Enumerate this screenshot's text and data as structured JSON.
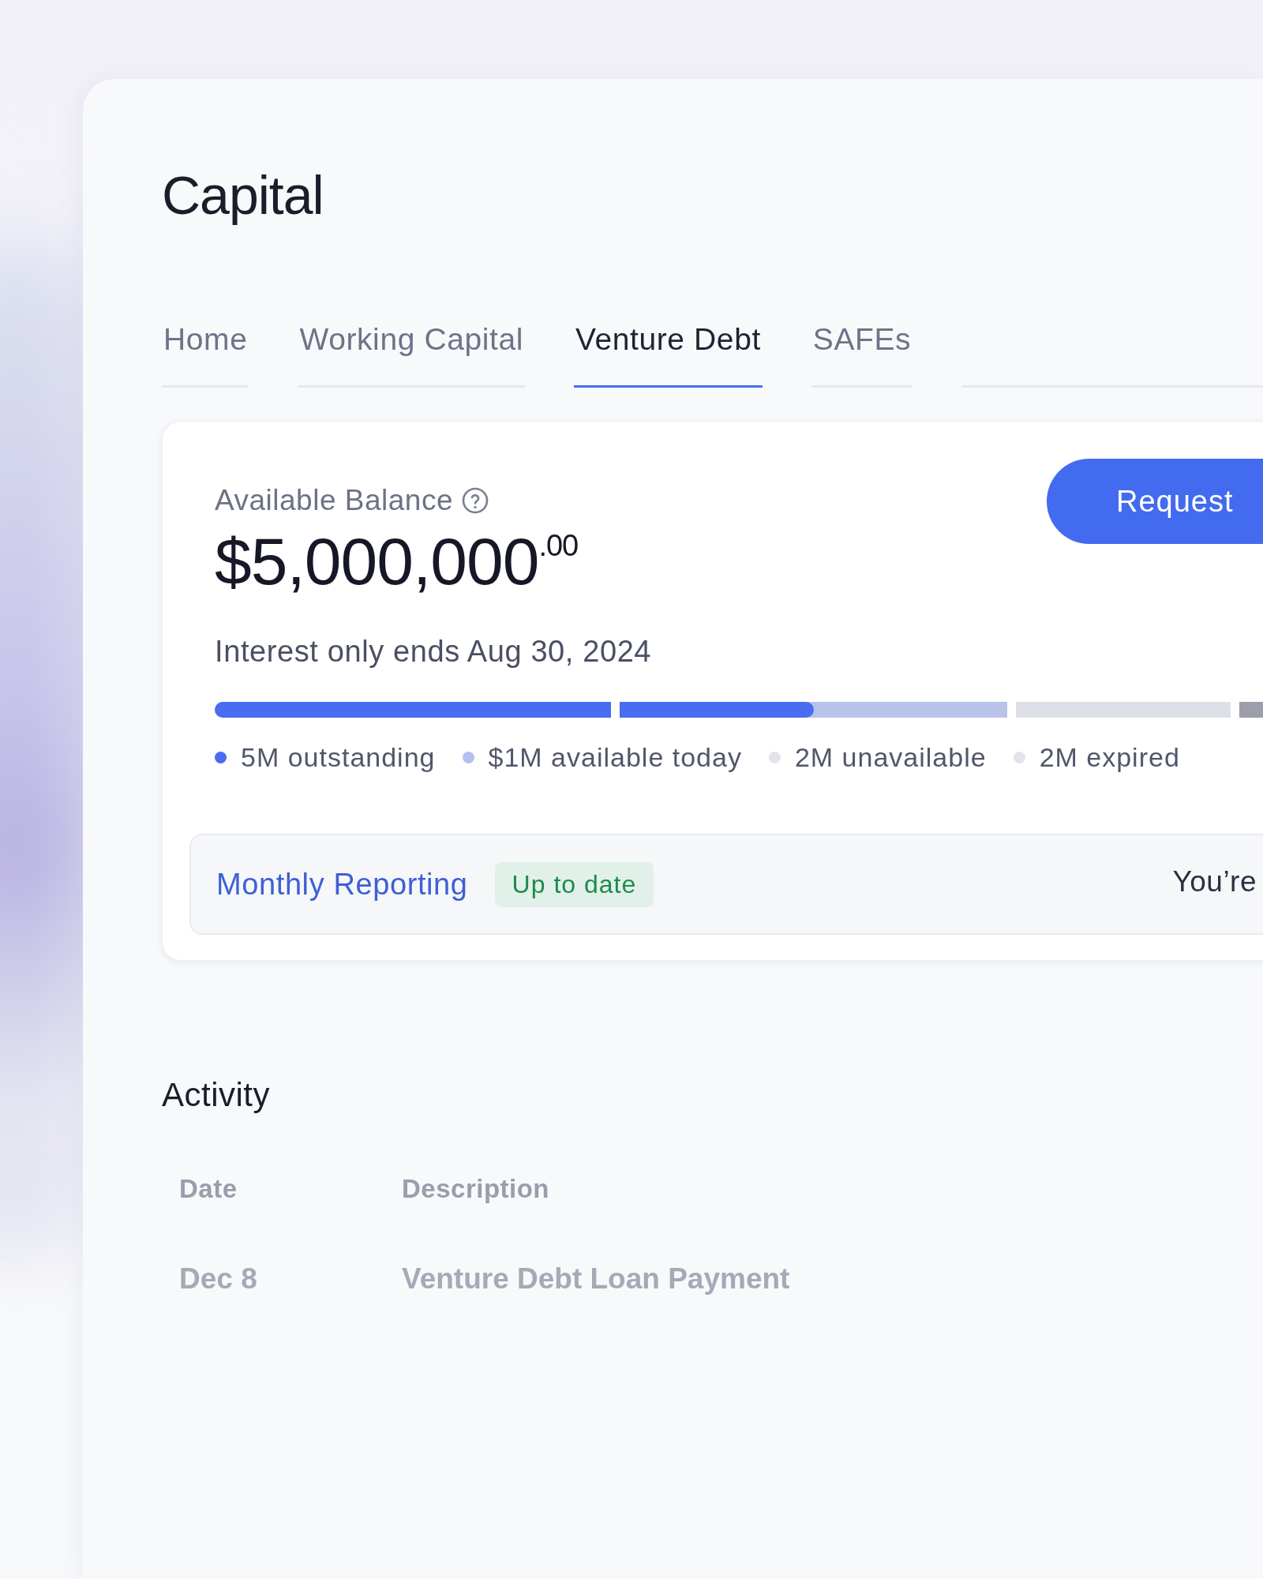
{
  "page": {
    "title": "Capital"
  },
  "tabs": [
    {
      "label": "Home",
      "selected": false
    },
    {
      "label": "Working Capital",
      "selected": false
    },
    {
      "label": "Venture Debt",
      "selected": true
    },
    {
      "label": "SAFEs",
      "selected": false
    }
  ],
  "balance": {
    "label": "Available Balance",
    "amount": "$5,000,000$^{.00}$",
    "button": "Request",
    "note": "Interest only ends Aug 30, 2024",
    "bar_segments": [
      {
        "color": "#4a6cf0"
      },
      {
        "color": "#b9c3ea",
        "level": 0.5
      },
      {
        "color": "#dde0e8"
      },
      {
        "color": "#9c9eab"
      }
    ],
    "legend": [
      {
        "label": "5M outstanding",
        "color": "#4a6cf0"
      },
      {
        "label": "$1M available today",
        "color": "#b3c0f0"
      },
      {
        "label": "2M unavailable",
        "color": "#e1e4ea"
      },
      {
        "label": "2M expired",
        "color": "#e1e4ea"
      }
    ]
  },
  "reporting": {
    "link": "Monthly Reporting",
    "status": "Up to date",
    "message": "You’re"
  },
  "activity": {
    "title": "Activity",
    "columns": [
      "Date",
      "Description"
    ],
    "rows": [
      [
        "Dec 8",
        "Venture Debt Loan Payment"
      ]
    ]
  }
}
